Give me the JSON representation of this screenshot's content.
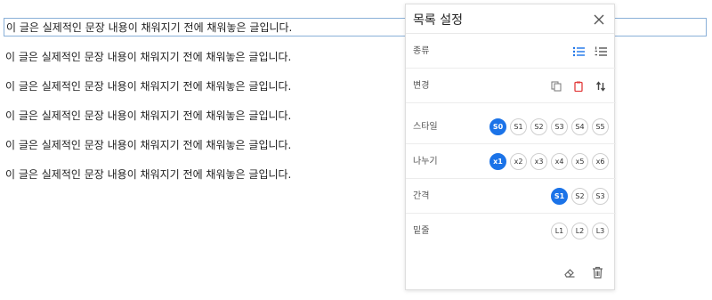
{
  "editor": {
    "lines": [
      "이 글은 실제적인 문장 내용이 채워지기 전에 채워놓은 글입니다.",
      "이 글은 실제적인 문장 내용이 채워지기 전에 채워놓은 글입니다.",
      "이 글은 실제적인 문장 내용이 채워지기 전에 채워놓은 글입니다.",
      "이 글은 실제적인 문장 내용이 채워지기 전에 채워놓은 글입니다.",
      "이 글은 실제적인 문장 내용이 채워지기 전에 채워놓은 글입니다.",
      "이 글은 실제적인 문장 내용이 채워지기 전에 채워놓은 글입니다."
    ]
  },
  "panel": {
    "title": "목록 설정",
    "rows": {
      "type": {
        "label": "종류"
      },
      "change": {
        "label": "변경"
      },
      "style": {
        "label": "스타일",
        "options": [
          "S0",
          "S1",
          "S2",
          "S3",
          "S4",
          "S5"
        ],
        "selected": "S0"
      },
      "divide": {
        "label": "나누기",
        "options": [
          "x1",
          "x2",
          "x3",
          "x4",
          "x5",
          "x6"
        ],
        "selected": "x1"
      },
      "spacing": {
        "label": "간격",
        "options": [
          "S1",
          "S2",
          "S3"
        ],
        "selected": "S1"
      },
      "underline": {
        "label": "밑줄",
        "options": [
          "L1",
          "L2",
          "L3"
        ],
        "selected": ""
      }
    }
  },
  "icons": {
    "close": "close-icon",
    "bullet_list": "bullet-list-icon",
    "numbered_list": "numbered-list-icon",
    "copy": "copy-icon",
    "clipboard": "clipboard-icon",
    "swap": "swap-icon",
    "eraser": "eraser-icon",
    "delete": "trash-icon"
  },
  "colors": {
    "accent": "#1b73e8",
    "danger": "#e23b3b",
    "icon": "#666666"
  }
}
